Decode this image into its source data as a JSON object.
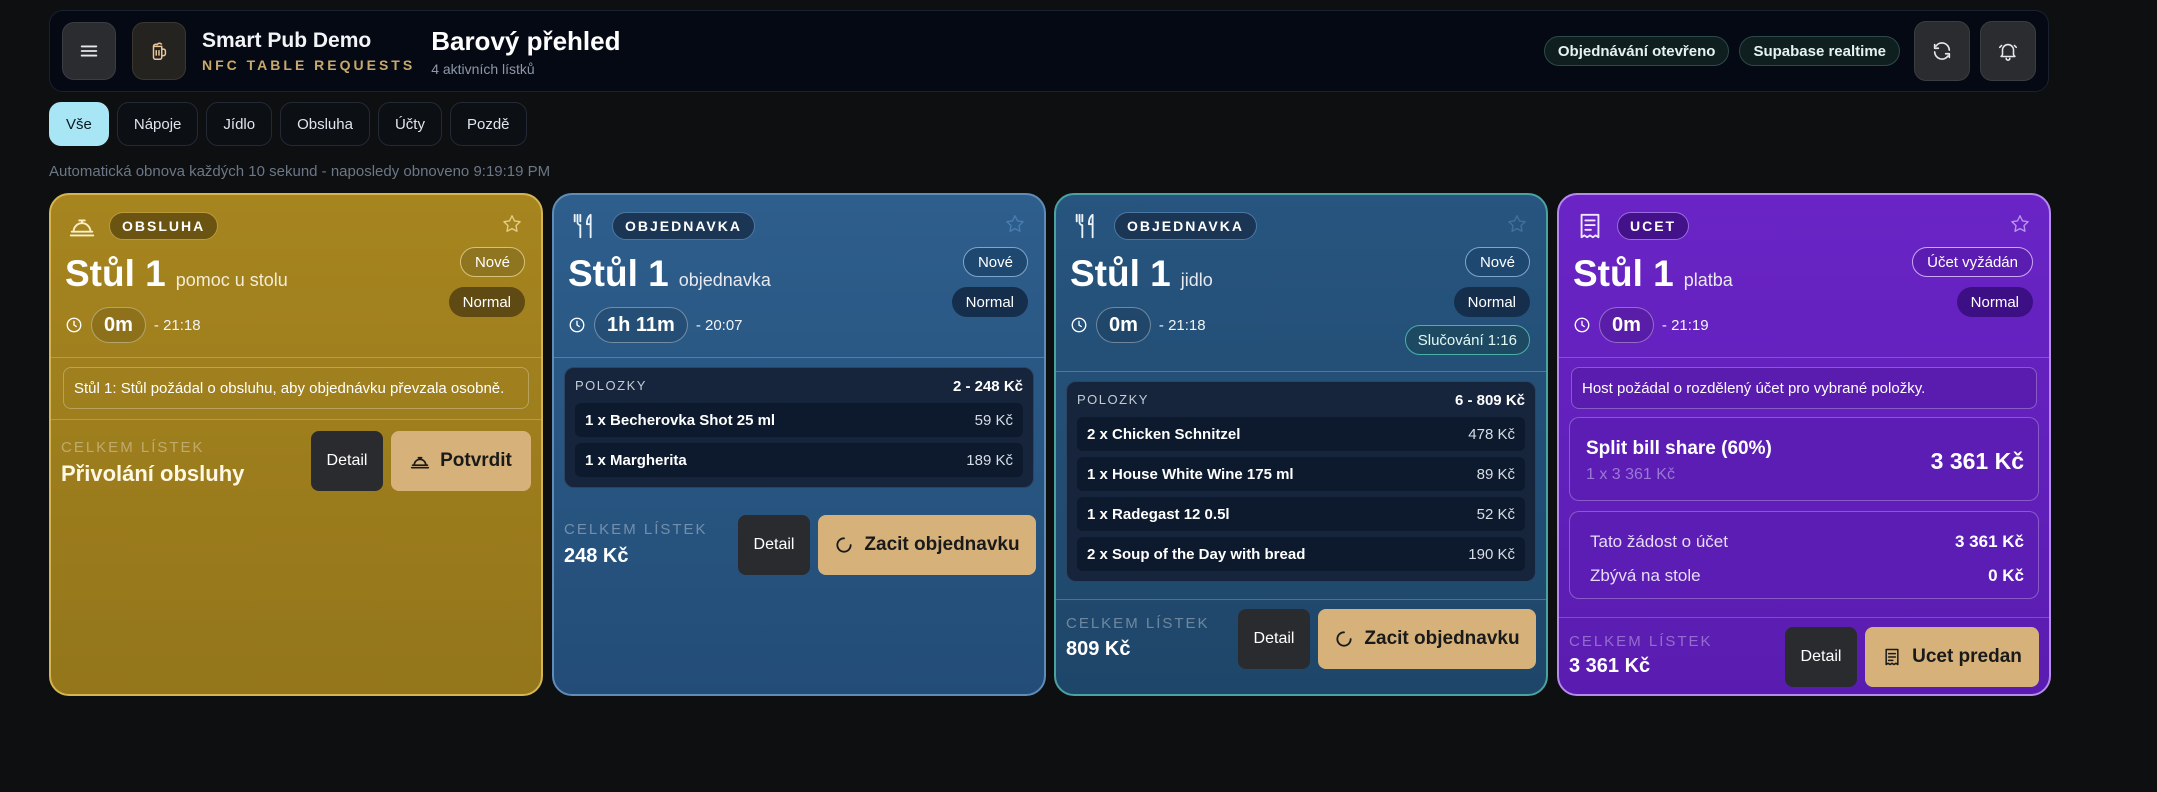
{
  "header": {
    "brand_name": "Smart Pub Demo",
    "brand_sub": "NFC TABLE REQUESTS",
    "title": "Barový přehled",
    "subtitle": "4 aktivních lístků",
    "pill_ordering": "Objednávání otevřeno",
    "pill_realtime": "Supabase realtime"
  },
  "filters": [
    {
      "label": "Vše",
      "active": true
    },
    {
      "label": "Nápoje"
    },
    {
      "label": "Jídlo"
    },
    {
      "label": "Obsluha"
    },
    {
      "label": "Účty"
    },
    {
      "label": "Pozdě"
    }
  ],
  "refresh_text": "Automatická obnova každých 10 sekund - naposledy obnoveno 9:19:19 PM",
  "cards": [
    {
      "type": "OBSLUHA",
      "table": "Stůl 1",
      "kind": "pomoc u stolu",
      "status": "Nové",
      "priority": "Normal",
      "elapsed": "0m",
      "time": "- 21:18",
      "note": "Stůl 1: Stůl požádal o obsluhu, aby objednávku převzala osobně.",
      "total_label": "CELKEM LÍSTEK",
      "total_value": "Přivolání obsluhy",
      "detail": "Detail",
      "action": "Potvrdit"
    },
    {
      "type": "OBJEDNAVKA",
      "table": "Stůl 1",
      "kind": "objednavka",
      "status": "Nové",
      "priority": "Normal",
      "elapsed": "1h 11m",
      "time": "- 20:07",
      "items_label": "POLOZKY",
      "items_sum": "2 - 248 Kč",
      "items": [
        {
          "name": "1 x Becherovka Shot 25 ml",
          "price": "59 Kč"
        },
        {
          "name": "1 x Margherita",
          "price": "189 Kč"
        }
      ],
      "total_label": "CELKEM LÍSTEK",
      "total_value": "248 Kč",
      "detail": "Detail",
      "action": "Zacit objednavku"
    },
    {
      "type": "OBJEDNAVKA",
      "table": "Stůl 1",
      "kind": "jidlo",
      "status": "Nové",
      "priority": "Normal",
      "merge": "Slučování 1:16",
      "elapsed": "0m",
      "time": "- 21:18",
      "items_label": "POLOZKY",
      "items_sum": "6 - 809 Kč",
      "items": [
        {
          "name": "2 x Chicken Schnitzel",
          "price": "478 Kč"
        },
        {
          "name": "1 x House White Wine 175 ml",
          "price": "89 Kč"
        },
        {
          "name": "1 x Radegast 12 0.5l",
          "price": "52 Kč"
        },
        {
          "name": "2 x Soup of the Day with bread",
          "price": "190 Kč"
        }
      ],
      "total_label": "CELKEM LÍSTEK",
      "total_value": "809 Kč",
      "detail": "Detail",
      "action": "Zacit objednavku"
    },
    {
      "type": "UCET",
      "table": "Stůl 1",
      "kind": "platba",
      "status": "Účet vyžádán",
      "priority": "Normal",
      "elapsed": "0m",
      "time": "- 21:19",
      "note": "Host požádal o rozdělený účet pro vybrané položky.",
      "split_title": "Split bill share (60%)",
      "split_sub": "1 x 3 361 Kč",
      "split_amount": "3 361 Kč",
      "sum_request_label": "Tato žádost o účet",
      "sum_request_value": "3 361 Kč",
      "sum_remaining_label": "Zbývá na stole",
      "sum_remaining_value": "0 Kč",
      "total_label": "CELKEM LÍSTEK",
      "total_value": "3 361 Kč",
      "detail": "Detail",
      "action": "Ucet predan"
    }
  ]
}
